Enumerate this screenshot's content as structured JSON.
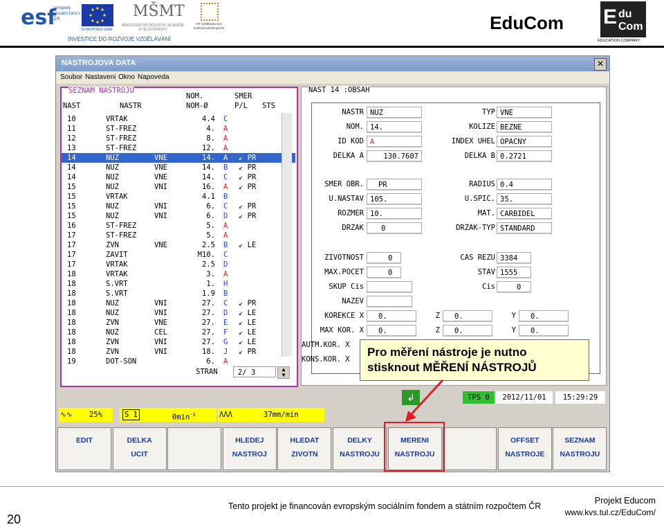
{
  "header": {
    "brand_title": "EduCom",
    "esf_text": "evropský sociální fond v ČR",
    "eu_text": "EVROPSKÁ UNIE",
    "msmt_text": "MINISTERSTVO ŠKOLSTVÍ, MLÁDEŽE A TĚLOVÝCHOVY",
    "op_text": "OP Vzdělávání pro konkurenceschopnost",
    "invest_text": "INVESTICE DO ROZVOJE VZDĚLÁVÁNÍ",
    "educom_logo_sub": "EDUCATION COMPANY"
  },
  "window": {
    "title": "NASTROJOVA DATA",
    "close": "✕",
    "menu": [
      "Soubor",
      "Nastaveni",
      "Okno",
      "Napoveda"
    ]
  },
  "left_panel": {
    "title": "SEZNAM NASTROJU",
    "col_nom": "NOM.",
    "col_smer": "SMER",
    "col_nast": "NAST",
    "col_nastr": "NASTR",
    "col_nomo": "NOM-Ø",
    "col_pl": "P/L",
    "col_sts": "STS",
    "rows": [
      {
        "n": "10",
        "t": "VRTAK",
        "s": "",
        "d": "4.4",
        "b": "C",
        "pl": ""
      },
      {
        "n": "11",
        "t": "ST-FREZ",
        "s": "",
        "d": "4.",
        "b": "A",
        "pl": ""
      },
      {
        "n": "12",
        "t": "ST-FREZ",
        "s": "",
        "d": "8.",
        "b": "A",
        "pl": ""
      },
      {
        "n": "13",
        "t": "ST-FREZ",
        "s": "",
        "d": "12.",
        "b": "A",
        "pl": ""
      },
      {
        "n": "14",
        "t": "NUZ",
        "s": "VNE",
        "d": "14.",
        "b": "A",
        "pl": "PR"
      },
      {
        "n": "14",
        "t": "NUZ",
        "s": "VNE",
        "d": "14.",
        "b": "B",
        "pl": "PR"
      },
      {
        "n": "14",
        "t": "NUZ",
        "s": "VNE",
        "d": "14.",
        "b": "C",
        "pl": "PR"
      },
      {
        "n": "15",
        "t": "NUZ",
        "s": "VNI",
        "d": "16.",
        "b": "A",
        "pl": "PR"
      },
      {
        "n": "15",
        "t": "VRTAK",
        "s": "",
        "d": "4.1",
        "b": "B",
        "pl": ""
      },
      {
        "n": "15",
        "t": "NUZ",
        "s": "VNI",
        "d": "6.",
        "b": "C",
        "pl": "PR"
      },
      {
        "n": "15",
        "t": "NUZ",
        "s": "VNI",
        "d": "6.",
        "b": "D",
        "pl": "PR"
      },
      {
        "n": "16",
        "t": "ST-FREZ",
        "s": "",
        "d": "5.",
        "b": "A",
        "pl": ""
      },
      {
        "n": "17",
        "t": "ST-FREZ",
        "s": "",
        "d": "5.",
        "b": "A",
        "pl": ""
      },
      {
        "n": "17",
        "t": "ZVN",
        "s": "VNE",
        "d": "2.5",
        "b": "B",
        "pl": "LE"
      },
      {
        "n": "17",
        "t": "ZAVIT",
        "s": "",
        "d": "M10.",
        "b": "C",
        "pl": ""
      },
      {
        "n": "17",
        "t": "VRTAK",
        "s": "",
        "d": "2.5",
        "b": "D",
        "pl": ""
      },
      {
        "n": "18",
        "t": "VRTAK",
        "s": "",
        "d": "3.",
        "b": "A",
        "pl": ""
      },
      {
        "n": "18",
        "t": "S.VRT",
        "s": "",
        "d": "1.",
        "b": "H",
        "pl": ""
      },
      {
        "n": "18",
        "t": "S.VRT",
        "s": "",
        "d": "1.9",
        "b": "B",
        "pl": ""
      },
      {
        "n": "18",
        "t": "NUZ",
        "s": "VNI",
        "d": "27.",
        "b": "C",
        "pl": "PR"
      },
      {
        "n": "18",
        "t": "NUZ",
        "s": "VNI",
        "d": "27.",
        "b": "D",
        "pl": "LE"
      },
      {
        "n": "18",
        "t": "ZVN",
        "s": "VNE",
        "d": "27.",
        "b": "E",
        "pl": "LE"
      },
      {
        "n": "18",
        "t": "NUZ",
        "s": "CEL",
        "d": "27.",
        "b": "F",
        "pl": "LE"
      },
      {
        "n": "18",
        "t": "ZVN",
        "s": "VNI",
        "d": "27.",
        "b": "G",
        "pl": "LE"
      },
      {
        "n": "18",
        "t": "ZVN",
        "s": "VNI",
        "d": "18.",
        "b": "J",
        "pl": "PR"
      },
      {
        "n": "19",
        "t": "DOT-SON",
        "s": "",
        "d": "6.",
        "b": "A",
        "pl": ""
      }
    ],
    "stran_label": "STRAN",
    "stran_value": "2/  3"
  },
  "right_panel": {
    "title": "NAST 14 :OBSAH",
    "fields": {
      "nastr_l": "NASTR",
      "nastr": "NUZ",
      "typ_l": "TYP",
      "typ": "VNE",
      "nom_l": "NOM.",
      "nom": "14.",
      "kolize_l": "KOLIZE",
      "kolize": "BEZNE",
      "idkod_l": "ID KOD",
      "idkod": "A",
      "index_l": "INDEX UHEL",
      "index": "OPACNY",
      "delkaa_l": "DELKA A",
      "delkaa": "130.7607",
      "delkab_l": "DELKA B",
      "delkab": "0.2721",
      "smer_l": "SMER OBR.",
      "smer": "PR",
      "radius_l": "RADIUS",
      "radius": "0.4",
      "unastav_l": "U.NASTAV",
      "unastav": "105.",
      "uspic_l": "U.SPIC.",
      "uspic": "35.",
      "rozmer_l": "ROZMER",
      "rozmer": "10.",
      "mat_l": "MAT.",
      "mat": "CARBIDEL",
      "drzak_l": "DRZAK",
      "drzak": "0",
      "drzaktyp_l": "DRZAK-TYP",
      "drzaktyp": "STANDARD",
      "zivot_l": "ZIVOTNOST",
      "zivot": "0",
      "casrezu_l": "CAS REZU",
      "casrezu": "3384",
      "maxpocet_l": "MAX.POCET",
      "maxpocet": "0",
      "stav_l": "STAV",
      "stav": "1555",
      "skup_l": "SKUP Cis",
      "skup": "",
      "cis_l": "Cis",
      "cis": "0",
      "nazev_l": "NAZEV",
      "nazev": "",
      "korx_l": "KOREKCE X",
      "korx": "0.",
      "korz_l": "Z",
      "korz": "0.",
      "kory_l": "Y",
      "kory": "0.",
      "maxkorx_l": "MAX KOR. X",
      "maxkorx": "0.",
      "maxkorz_l": "Z",
      "maxkorz": "0.",
      "maxkory_l": "Y",
      "maxkory": "0.",
      "autm_l": "AUTM.KOR. X",
      "kons_l": "KONS.KOR. X"
    }
  },
  "callout": {
    "line1": "Pro měření nástroje je nutno",
    "line2": "stisknout MĚŘENÍ NÁSTROJŮ"
  },
  "status": {
    "enter_icon": "↲",
    "tps": "TPS 0",
    "date": "2012/11/01",
    "time": "15:29:29",
    "feed_pct": "25%",
    "spindle": "S 1",
    "speed": "0min",
    "speed_sup": "-1",
    "feed_rate": "37mm/min"
  },
  "softkeys": [
    {
      "l1": "EDIT",
      "l2": ""
    },
    {
      "l1": "DELKA",
      "l2": "UCIT"
    },
    {
      "l1": "",
      "l2": ""
    },
    {
      "l1": "HLEDEJ",
      "l2": "NASTROJ"
    },
    {
      "l1": "HLEDAT",
      "l2": "ZIVOTN"
    },
    {
      "l1": "DELKY",
      "l2": "NASTROJU"
    },
    {
      "l1": "MERENI",
      "l2": "NASTROJU"
    },
    {
      "l1": "",
      "l2": ""
    },
    {
      "l1": "OFFSET",
      "l2": "NASTROJE"
    },
    {
      "l1": "SEZNAM",
      "l2": "NASTROJU"
    }
  ],
  "footer": {
    "page": "20",
    "funding": "Tento projekt je financován evropským sociálním fondem a státním rozpočtem ČR",
    "project": "Projekt Educom",
    "url": "www.kvs.tul.cz/EduCom/"
  },
  "colors": {
    "accent": "#b02cb0",
    "selection": "#3366cc",
    "highlight": "#e02020"
  }
}
